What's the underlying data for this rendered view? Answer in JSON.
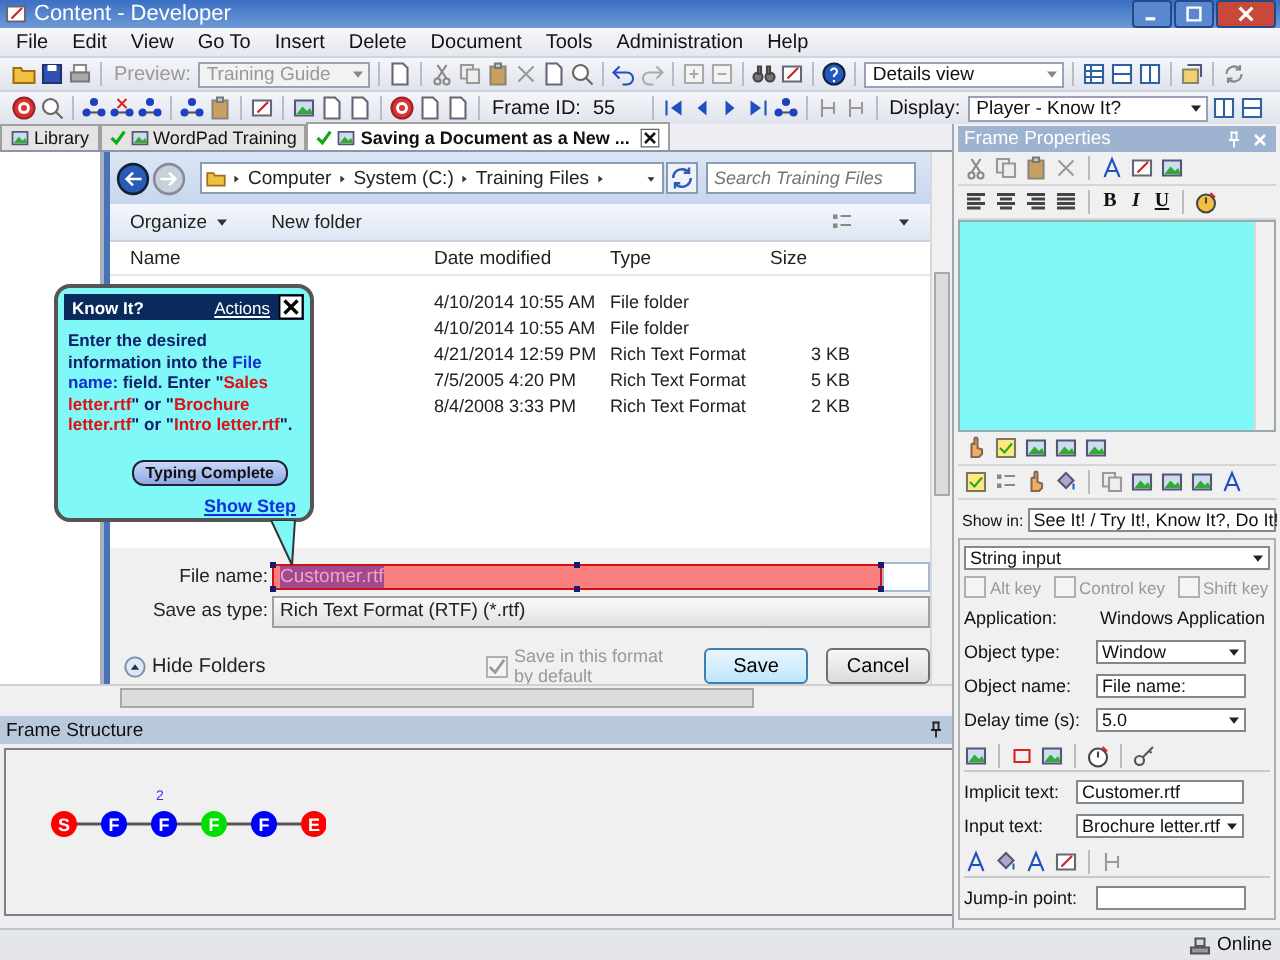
{
  "window": {
    "title": "Content - Developer"
  },
  "menu": [
    "File",
    "Edit",
    "View",
    "Go To",
    "Insert",
    "Delete",
    "Document",
    "Tools",
    "Administration",
    "Help"
  ],
  "toolbar": {
    "preview": {
      "label": "Preview:",
      "value": "Training Guide",
      "disabled": true
    },
    "view_value": "Details view",
    "frame_id_label": "Frame ID:",
    "frame_id": "55",
    "display_label": "Display:",
    "display_value": "Player - Know It?"
  },
  "tabs": [
    {
      "label": "Library",
      "selected": false,
      "checked": false
    },
    {
      "label": "WordPad Training",
      "selected": false,
      "checked": true
    },
    {
      "label": "Saving a Document as a New ...",
      "selected": true,
      "checked": true
    }
  ],
  "dialog": {
    "path": [
      "Computer",
      "System (C:)",
      "Training Files"
    ],
    "search": {
      "placeholder": "Search Training Files"
    },
    "organize": "Organize",
    "new_folder": "New folder",
    "columns": [
      "Name",
      "Date modified",
      "Type",
      "Size"
    ],
    "rows": [
      {
        "date": "4/10/2014 10:55 AM",
        "type": "File folder"
      },
      {
        "date": "4/10/2014 10:55 AM",
        "type": "File folder"
      },
      {
        "date": "4/21/2014 12:59 PM",
        "type": "Rich Text Format",
        "size": "3 KB"
      },
      {
        "date": "7/5/2005 4:20 PM",
        "type": "Rich Text Format",
        "size": "5 KB"
      },
      {
        "date": "8/4/2008 3:33 PM",
        "type": "Rich Text Format",
        "size": "2 KB"
      }
    ],
    "file_name_label": "File name:",
    "file_name": "Customer.rtf",
    "save_type_label": "Save as type:",
    "save_type": "Rich Text Format (RTF) (*.rtf)",
    "hide_folders": "Hide Folders",
    "save_default": {
      "label": "Save in this format by default",
      "checked": true,
      "disabled": true
    },
    "buttons": [
      "Save",
      "Cancel"
    ]
  },
  "bubble": {
    "title": "Know It?",
    "actions": "Actions",
    "text": [
      {
        "kind": "plain",
        "text": "Enter the desired information into the "
      },
      {
        "kind": "field",
        "text": "File name:"
      },
      {
        "kind": "plain",
        "text": " field. Enter \""
      },
      {
        "kind": "value",
        "text": "Sales letter.rtf"
      },
      {
        "kind": "plain",
        "text": "\" or \""
      },
      {
        "kind": "value",
        "text": "Brochure letter.rtf"
      },
      {
        "kind": "plain",
        "text": "\" or \""
      },
      {
        "kind": "value",
        "text": "Intro letter.rtf"
      },
      {
        "kind": "plain",
        "text": "\"."
      }
    ],
    "button": "Typing Complete",
    "link": "Show Step"
  },
  "properties": {
    "title": "Frame Properties",
    "format_buttons": [
      "B",
      "I",
      "U"
    ],
    "show_in_label": "Show in:",
    "show_in": "See It! / Try It!, Know It?, Do It!",
    "action": "String input",
    "keys": [
      {
        "label": "Alt key",
        "checked": false,
        "disabled": true
      },
      {
        "label": "Control key",
        "checked": false,
        "disabled": true
      },
      {
        "label": "Shift key",
        "checked": false,
        "disabled": true
      }
    ],
    "fields": [
      {
        "label": "Application:",
        "value": "Windows Application",
        "kind": "static"
      },
      {
        "label": "Object type:",
        "value": "Window",
        "kind": "dropdown"
      },
      {
        "label": "Object name:",
        "value": "File name:",
        "kind": "text"
      },
      {
        "label": "Delay time (s):",
        "value": "5.0",
        "kind": "dropdown"
      }
    ],
    "text_fields": [
      {
        "label": "Implicit text:",
        "value": "Customer.rtf",
        "kind": "text"
      },
      {
        "label": "Input text:",
        "value": "Brochure letter.rtf",
        "kind": "dropdown"
      }
    ],
    "jump_in_label": "Jump-in point:"
  },
  "frame_structure": {
    "title": "Frame Structure",
    "nodes": [
      {
        "label": "S",
        "color": "#ff0000"
      },
      {
        "label": "F",
        "color": "#0000ff"
      },
      {
        "label": "F",
        "color": "#0000ff",
        "note": "2"
      },
      {
        "label": "F",
        "color": "#00e000"
      },
      {
        "label": "F",
        "color": "#0000ff"
      },
      {
        "label": "E",
        "color": "#ff0000"
      }
    ]
  },
  "status": {
    "text": "Online"
  }
}
